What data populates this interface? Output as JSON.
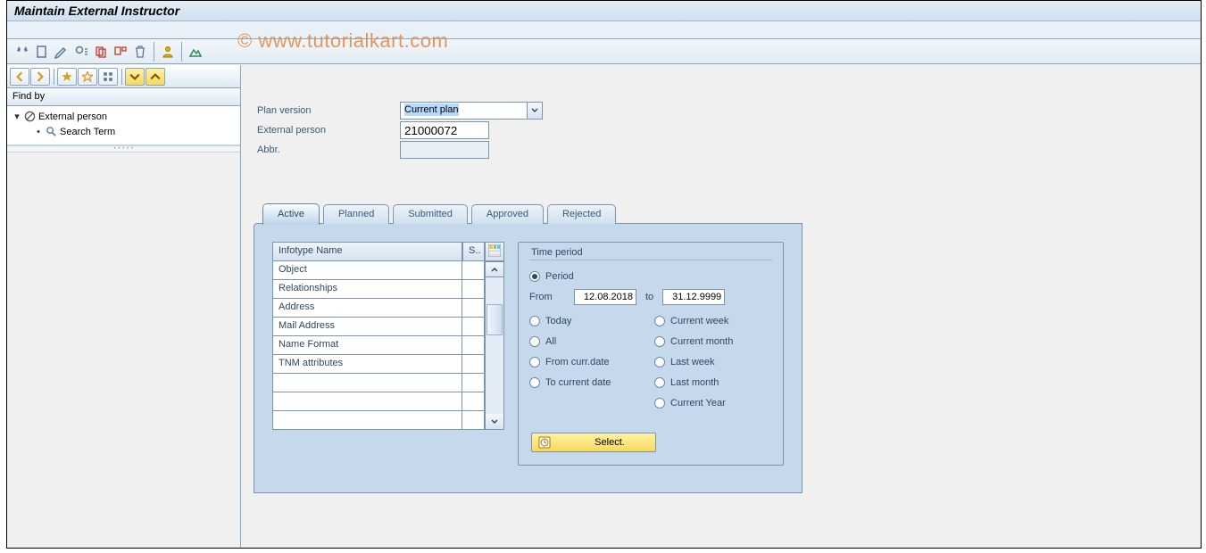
{
  "title": "Maintain External Instructor",
  "watermark": "© www.tutorialkart.com",
  "left": {
    "findby_label": "Find by",
    "tree": {
      "root": "External person",
      "child": "Search Term"
    }
  },
  "form": {
    "plan_version_label": "Plan version",
    "plan_version_value": "Current plan",
    "external_person_label": "External person",
    "external_person_value": "21000072",
    "abbr_label": "Abbr.",
    "abbr_value": ""
  },
  "tabs": {
    "active": "Active",
    "planned": "Planned",
    "submitted": "Submitted",
    "approved": "Approved",
    "rejected": "Rejected"
  },
  "infotype": {
    "header_name": "Infotype Name",
    "header_s": "S..",
    "rows": [
      "Object",
      "Relationships",
      "Address",
      "Mail Address",
      "Name Format",
      "TNM attributes",
      "",
      "",
      ""
    ]
  },
  "timeperiod": {
    "title": "Time period",
    "period": "Period",
    "from": "From",
    "from_val": "12.08.2018",
    "to": "to",
    "to_val": "31.12.9999",
    "today": "Today",
    "all": "All",
    "from_curr": "From curr.date",
    "to_curr": "To current date",
    "curr_week": "Current week",
    "curr_month": "Current month",
    "last_week": "Last week",
    "last_month": "Last month",
    "curr_year": "Current Year",
    "select_btn": "Select."
  }
}
